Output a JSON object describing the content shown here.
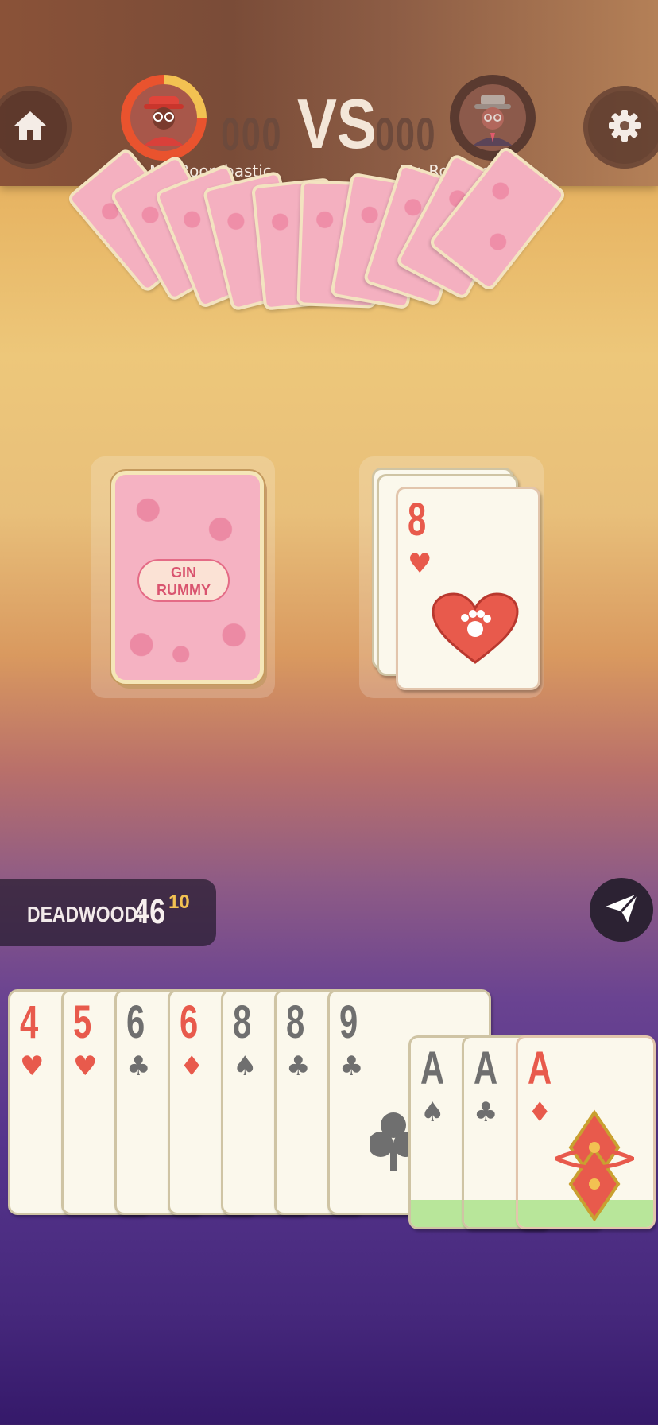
{
  "header": {
    "vs_label": "VS",
    "player1": {
      "name": "Mr. Boombastic",
      "score": "000",
      "timer_fraction": 0.75
    },
    "player2": {
      "name": "Mr. Roberto",
      "score": "000"
    }
  },
  "deck": {
    "logo_line1": "GIN",
    "logo_line2": "RUMMY"
  },
  "discard": {
    "top_card": {
      "rank": "8",
      "suit": "hearts",
      "suit_symbol": "♥"
    }
  },
  "deadwood": {
    "label": "DEADWOOD:",
    "value": "46",
    "secondary": "10"
  },
  "hand": [
    {
      "rank": "4",
      "suit_symbol": "♥",
      "color": "red"
    },
    {
      "rank": "5",
      "suit_symbol": "♥",
      "color": "red"
    },
    {
      "rank": "6",
      "suit_symbol": "♣",
      "color": "grey"
    },
    {
      "rank": "6",
      "suit_symbol": "♦",
      "color": "red"
    },
    {
      "rank": "8",
      "suit_symbol": "♠",
      "color": "grey"
    },
    {
      "rank": "8",
      "suit_symbol": "♣",
      "color": "grey"
    },
    {
      "rank": "9",
      "suit_symbol": "♣",
      "color": "grey"
    }
  ],
  "meld": [
    {
      "rank": "A",
      "suit_symbol": "♠",
      "color": "grey"
    },
    {
      "rank": "A",
      "suit_symbol": "♣",
      "color": "grey"
    },
    {
      "rank": "A",
      "suit_symbol": "♦",
      "color": "red"
    }
  ],
  "icons": {
    "home": "home-icon",
    "settings": "gear-icon",
    "send": "send-icon"
  },
  "colors": {
    "accent_yellow": "#f2c152",
    "red_suit": "#e85a4c",
    "meld_green": "#b8e69a"
  }
}
